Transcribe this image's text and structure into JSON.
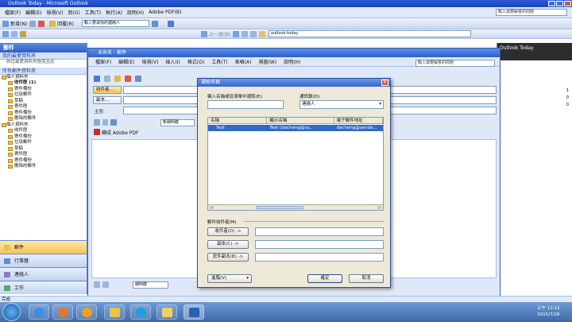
{
  "outlook": {
    "title": "Outlook Today - Microsoft Outlook",
    "menu": [
      "檔案(F)",
      "編輯(E)",
      "檢視(V)",
      "到(G)",
      "工具(T)",
      "執行(A)",
      "說明(H)",
      "Adobe PDF(B)"
    ],
    "help_search_placeholder": "輸入需要解答的問題",
    "tb_new": "新增(N)",
    "tb_reply": "回覆(R)",
    "tb_find_contact": "輸入要尋找的連絡人",
    "tb_back": "上一頁(B)",
    "address": "outlook:today"
  },
  "nav": {
    "header": "郵件",
    "favorites_header": "我的最愛資料夾",
    "favorites_hint": "將您最愛資料夾拖曳至此",
    "all_folders_header": "所有郵件資料夾",
    "tree1": [
      "個人資料夾",
      "收件匣 (1)",
      "寄件備份",
      "垃圾郵件",
      "草稿",
      "寄件匣",
      "寄件備份",
      "刪除的郵件"
    ],
    "tree2": [
      "個人資料夾",
      "收件匣",
      "寄件備份",
      "垃圾郵件",
      "草稿",
      "寄件匣",
      "寄件備份",
      "刪除的郵件"
    ],
    "buttons": [
      "郵件",
      "行事曆",
      "連絡人",
      "工作"
    ]
  },
  "right_pane": {
    "title": "Outlook Today",
    "counts": [
      "1",
      "0",
      "0"
    ]
  },
  "message": {
    "title": "未命名 - 郵件",
    "menu": [
      "檔案(F)",
      "編輯(E)",
      "檢視(V)",
      "插入(I)",
      "格式(O)",
      "工具(T)",
      "表格(A)",
      "視窗(W)",
      "說明(H)"
    ],
    "help_search_placeholder": "輸入需要解答的問題",
    "to_button": "收件者...",
    "cc_button": "副本...",
    "subject_label": "主旨:",
    "attach_label": "附加檔案",
    "font_name": "新細明體",
    "adobe": "轉成 Adobe PDF",
    "bottom_font": "細明體"
  },
  "dialog": {
    "title": "選取名稱",
    "type_label": "鍵入名稱或從清單中選取(E):",
    "address_book_label": "通訊錄(D):",
    "address_book_value": "連絡人",
    "columns": [
      "名稱",
      "顯示名稱",
      "電子郵件地址"
    ],
    "row": [
      "Test",
      "Test (dacheng@sy...",
      "dacheng@senda..."
    ],
    "recipients_label": "郵件收件者(M)",
    "to_btn": "收件者(O) ->",
    "cc_btn": "副本(C) ->",
    "bcc_btn": "密件副本(B) ->",
    "advanced_btn": "進階(V)",
    "ok_btn": "確定",
    "cancel_btn": "取消"
  },
  "statusbar": {
    "text": "完成"
  },
  "taskbar": {
    "time": "上午 11:12",
    "date": "2015/7/28"
  }
}
